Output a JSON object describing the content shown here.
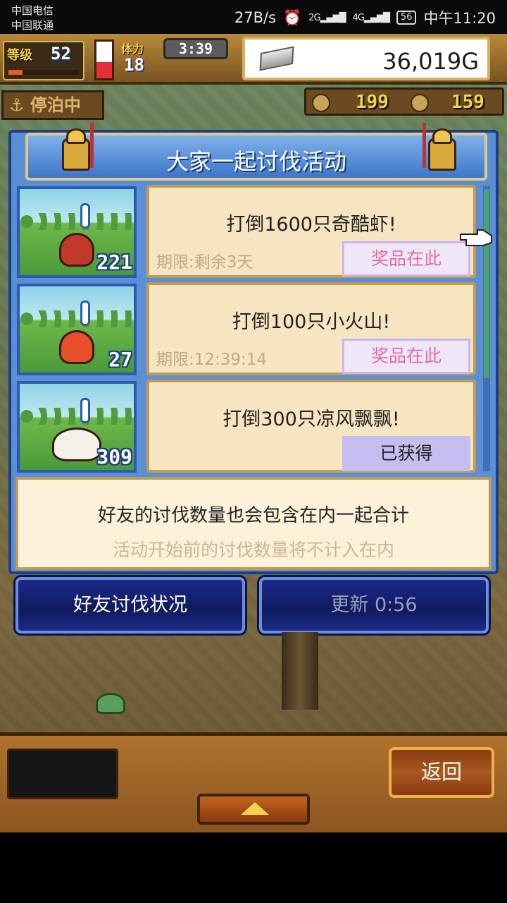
{
  "statusbar": {
    "carrier1": "中国电信",
    "carrier2": "中国联通",
    "speed": "27B/s",
    "alarm_icon": "alarm-icon",
    "signal_2g": "2G",
    "signal_4g": "4G",
    "battery": "56",
    "time": "中午11:20"
  },
  "hud": {
    "level_label": "等级",
    "level": "52",
    "level_progress": 0.2,
    "stamina_fraction": 0.45,
    "hp_label": "体力",
    "hp": "18",
    "timer": "3:39",
    "gold": "36,019G",
    "docked_label": "停泊中",
    "counter1": "199",
    "counter2": "159"
  },
  "dialog": {
    "title": "大家一起讨伐活动",
    "events": [
      {
        "task": "打倒1600只奇酷虾!",
        "deadline": "期限:剩余3天",
        "count": "221",
        "button": "奖品在此",
        "claimed": false,
        "monster_color": "#c0392b"
      },
      {
        "task": "打倒100只小火山!",
        "deadline": "期限:12:39:14",
        "count": "27",
        "button": "奖品在此",
        "claimed": false,
        "monster_color": "#e8502a"
      },
      {
        "task": "打倒300只凉风飘飘!",
        "deadline": "",
        "count": "309",
        "button": "已获得",
        "claimed": true,
        "monster_color": "#f4f1ea"
      }
    ],
    "note_main": "好友的讨伐数量也会包含在内一起合计",
    "note_sub": "活动开始前的讨伐数量将不计入在内"
  },
  "buttons": {
    "friends": "好友讨伐状况",
    "refresh": "更新 0:56",
    "back": "返回"
  },
  "colors": {
    "dialog_blue": "#5a8fd6",
    "reward_pink": "#e06ca8",
    "claimed_purple": "#c6bef0"
  }
}
